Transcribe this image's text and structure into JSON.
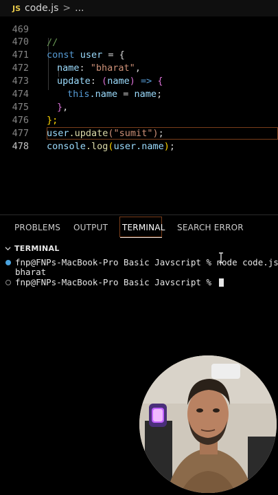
{
  "breadcrumb": {
    "lang_badge": "JS",
    "file": "code.js",
    "separator": ">",
    "ellipsis": "..."
  },
  "editor": {
    "lines": [
      {
        "num": "469",
        "text": "//"
      },
      {
        "num": "470",
        "text": "const user = {"
      },
      {
        "num": "471",
        "text": "name: \"bharat\","
      },
      {
        "num": "472",
        "text": "update: (name) => {"
      },
      {
        "num": "473",
        "text": "this.name = name;"
      },
      {
        "num": "474",
        "text": "},"
      },
      {
        "num": "475",
        "text": "};"
      },
      {
        "num": "476",
        "text": "user.update(\"sumit\");"
      },
      {
        "num": "477",
        "text": "console.log(user.name);"
      },
      {
        "num": "478",
        "text": ""
      }
    ],
    "tokens": {
      "const": "const",
      "user": "user",
      "eq_brace": " = {",
      "name_key": "name",
      "colon": ": ",
      "bharat": "\"bharat\"",
      "comma": ",",
      "update_key": "update",
      "open_paren": "(",
      "param": "name",
      "close_paren": ")",
      "arrow": " =>",
      "open_brace": " {",
      "this": "this",
      "dot_name": ".name",
      "assign": " = ",
      "name_val": "name",
      "semi": ";",
      "close_inner": "}",
      "inner_comma": ",",
      "close_outer": "};",
      "user2": "user",
      "dot_update": ".update",
      "sumit_arg": "(\"sumit\")",
      "semi2": ";",
      "console": "console",
      "dot_log": ".log",
      "log_open": "(",
      "user3": "user",
      "dot_name2": ".name",
      "log_close": ")",
      "semi3": ";"
    }
  },
  "panel": {
    "tabs": [
      "PROBLEMS",
      "OUTPUT",
      "TERMINAL",
      "SEARCH ERROR"
    ],
    "active_tab": "TERMINAL",
    "section_title": "TERMINAL",
    "terminal_lines": [
      "fnp@FNPs-MacBook-Pro Basic Javscript % node code.js",
      "bharat",
      "fnp@FNPs-MacBook-Pro Basic Javscript % "
    ]
  },
  "colors": {
    "accent_border": "#7a3e1a",
    "prompt_dot": "#4aa3df"
  }
}
